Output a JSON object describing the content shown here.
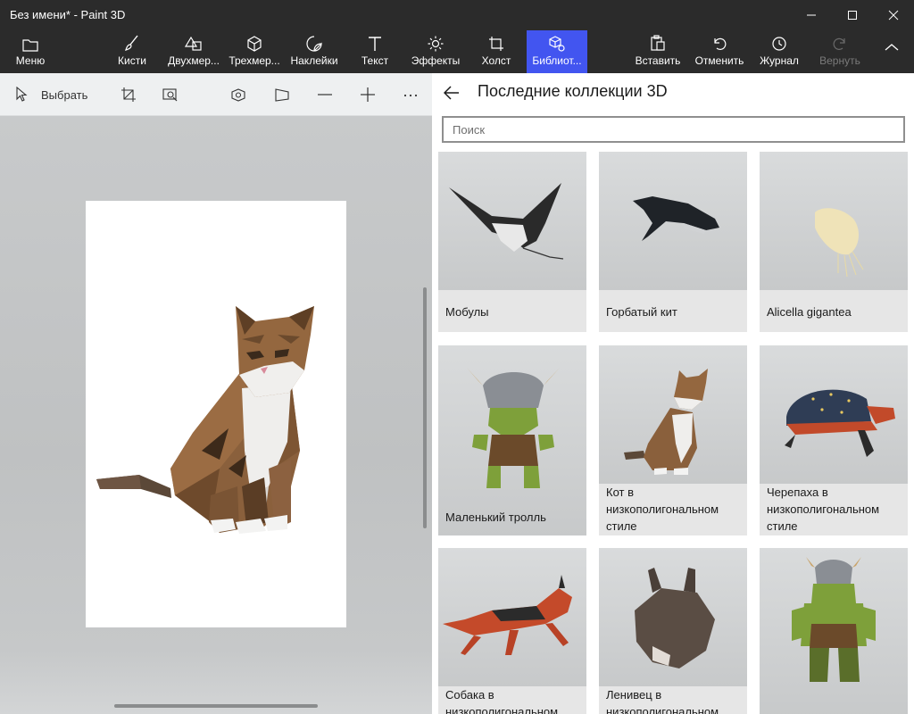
{
  "window": {
    "title": "Без имени* - Paint 3D"
  },
  "toolbar": {
    "menu": "Меню",
    "brushes": "Кисти",
    "shapes2d": "Двухмер...",
    "shapes3d": "Трехмер...",
    "stickers": "Наклейки",
    "text": "Текст",
    "effects": "Эффекты",
    "canvas": "Холст",
    "library": "Библиот...",
    "paste": "Вставить",
    "undo": "Отменить",
    "history": "Журнал",
    "redo": "Вернуть"
  },
  "subtoolbar": {
    "select": "Выбрать"
  },
  "library": {
    "title": "Последние коллекции 3D",
    "search_placeholder": "Поиск",
    "items": [
      {
        "label": "Мобулы"
      },
      {
        "label": "Горбатый кит"
      },
      {
        "label": "Alicella gigantea"
      },
      {
        "label": "Маленький тролль"
      },
      {
        "label": "Кот в низкополигональном стиле"
      },
      {
        "label": "Черепаха в низкополигональном стиле"
      },
      {
        "label": "Собака в низкополигональном стиле"
      },
      {
        "label": "Ленивец в низкополигональном стиле"
      },
      {
        "label": ""
      }
    ]
  },
  "colors": {
    "accent": "#4255f0",
    "chrome": "#2b2b2b"
  }
}
